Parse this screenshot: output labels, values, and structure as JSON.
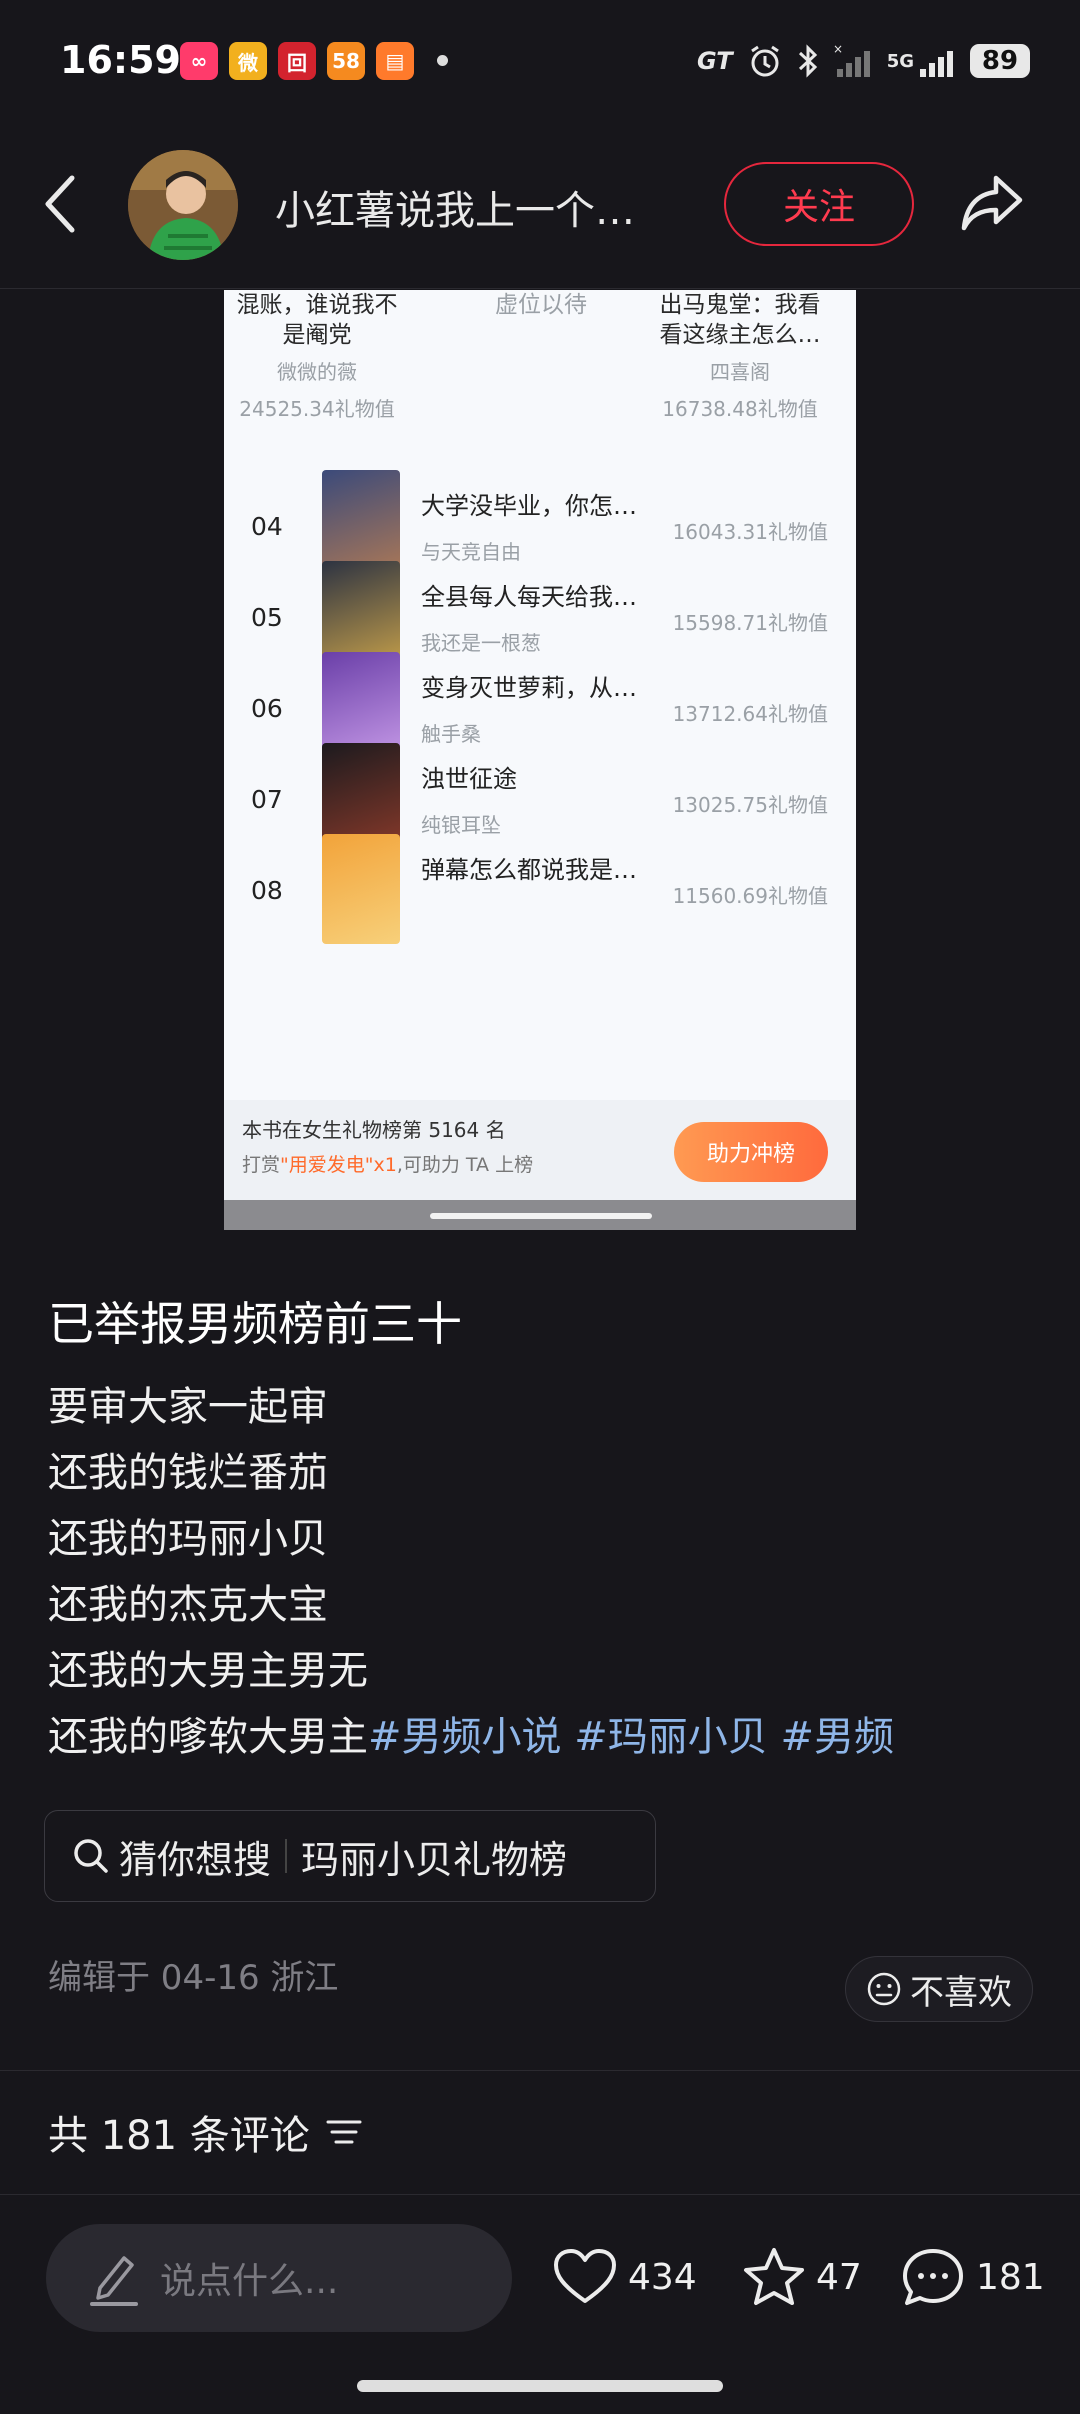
{
  "status_bar": {
    "time": "16:59",
    "app_icons": [
      {
        "name": "app-icon-1",
        "color": "#ff3b6b",
        "glyph": "∞"
      },
      {
        "name": "weibo-icon",
        "color": "#f2b01e",
        "glyph": "微"
      },
      {
        "name": "app-icon-3",
        "color": "#d3232e",
        "glyph": "回"
      },
      {
        "name": "58-icon",
        "color": "#f58a1f",
        "glyph": "58"
      },
      {
        "name": "book-icon",
        "color": "#ff7a2b",
        "glyph": "▤"
      }
    ],
    "network_badge": "GT",
    "network_type": "5G",
    "battery": "89"
  },
  "header": {
    "back_icon": "chevron-left-icon",
    "title": "小红薯说我上一个…",
    "follow_label": "关注",
    "share_icon": "share-arrow-icon"
  },
  "screenshot": {
    "top_row": {
      "left": {
        "title_line1": "混账，谁说我不",
        "title_line2": "是阉党",
        "author": "微微的薇",
        "value": "24525.34礼物值"
      },
      "middle": {
        "title": "虚位以待"
      },
      "right": {
        "title_line1": "出马鬼堂：我看",
        "title_line2": "看这缘主怎么…",
        "author": "四喜阁",
        "value": "16738.48礼物值"
      }
    },
    "rows": [
      {
        "rank": "04",
        "title": "大学没毕业，你怎…",
        "author": "与天竞自由",
        "value": "16043.31礼物值",
        "cover_colors": [
          "#3b4a7a",
          "#b07a55"
        ]
      },
      {
        "rank": "05",
        "title": "全县每人每天给我…",
        "author": "我还是一根葱",
        "value": "15598.71礼物值",
        "cover_colors": [
          "#2d3342",
          "#c9a24a"
        ]
      },
      {
        "rank": "06",
        "title": "变身灭世萝莉，从…",
        "author": "触手桑",
        "value": "13712.64礼物值",
        "cover_colors": [
          "#6a3fa8",
          "#c79be8"
        ]
      },
      {
        "rank": "07",
        "title": "浊世征途",
        "author": "纯银耳坠",
        "value": "13025.75礼物值",
        "cover_colors": [
          "#1c1a1e",
          "#8a3a2a"
        ]
      },
      {
        "rank": "08",
        "title": "弹幕怎么都说我是…",
        "author": "",
        "value": "11560.69礼物值",
        "cover_colors": [
          "#f2a33a",
          "#f7d07a"
        ]
      }
    ],
    "footer": {
      "rank_text": "本书在女生礼物榜第 5164 名",
      "hint_prefix": "打赏",
      "hint_highlight": "\"用爱发电\"x1",
      "hint_suffix": ",可助力 TA 上榜",
      "boost_label": "助力冲榜"
    }
  },
  "post": {
    "title": "已举报男频榜前三十",
    "lines": [
      "要审大家一起审",
      "还我的钱烂番茄",
      "还我的玛丽小贝",
      "还我的杰克大宝",
      "还我的大男主男无"
    ],
    "last_line_text": "还我的嗲软大男主",
    "tags": [
      "#男频小说",
      "#玛丽小贝",
      "#男频"
    ]
  },
  "search_suggestion": {
    "label": "猜你想搜",
    "query": "玛丽小贝礼物榜"
  },
  "meta": {
    "edited": "编辑于 04-16 浙江",
    "dislike_label": "不喜欢"
  },
  "comments": {
    "count_label": "共 181 条评论"
  },
  "bottom_bar": {
    "placeholder": "说点什么...",
    "likes": "434",
    "favorites": "47",
    "comments": "181"
  }
}
